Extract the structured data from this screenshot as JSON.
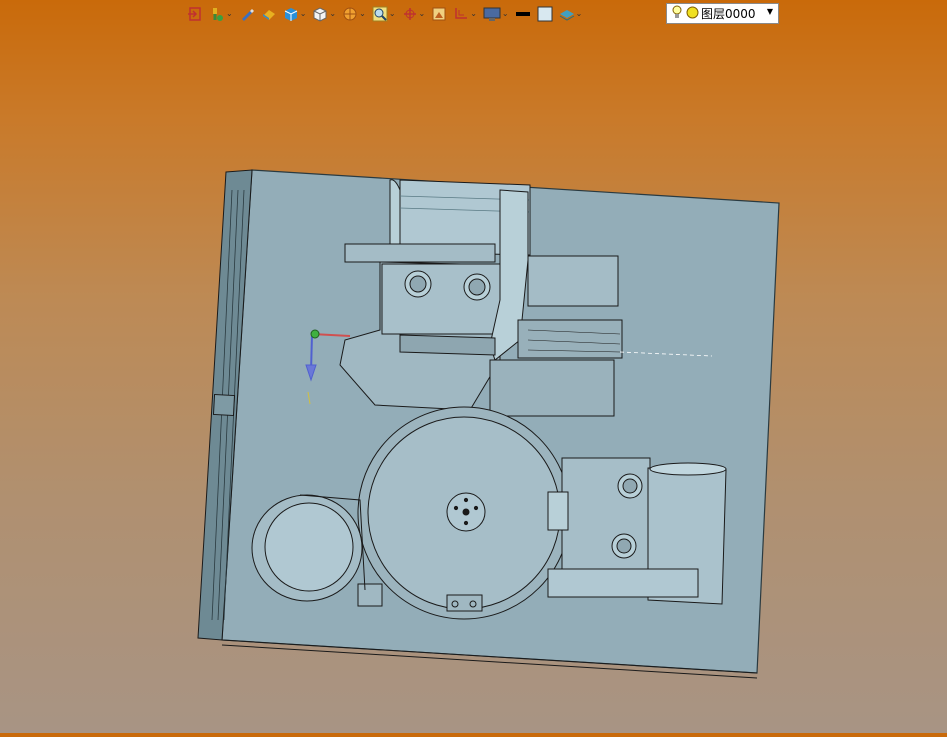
{
  "toolbar": {
    "buttons": [
      {
        "name": "exit-sketch-icon",
        "has_dropdown": false
      },
      {
        "name": "paint-tool-icon",
        "has_dropdown": true
      },
      {
        "name": "pencil-icon",
        "has_dropdown": false
      },
      {
        "name": "eraser-icon",
        "has_dropdown": false
      },
      {
        "name": "solid-box-icon",
        "has_dropdown": true
      },
      {
        "name": "view-cube-icon",
        "has_dropdown": true
      },
      {
        "name": "render-style-icon",
        "has_dropdown": true
      },
      {
        "name": "zoom-icon",
        "has_dropdown": true
      },
      {
        "name": "coordinate-axes-icon",
        "has_dropdown": true
      },
      {
        "name": "picture-frame-icon",
        "has_dropdown": false
      },
      {
        "name": "section-view-icon",
        "has_dropdown": true
      },
      {
        "name": "display-monitor-icon",
        "has_dropdown": true
      },
      {
        "name": "line-color-icon",
        "has_dropdown": false
      },
      {
        "name": "fill-color-icon",
        "has_dropdown": false
      },
      {
        "name": "layer-stack-icon",
        "has_dropdown": true
      }
    ],
    "layer": {
      "current": "图层0000",
      "visible_icon": "lightbulb-icon",
      "state_icon": "yellow-circle-icon"
    }
  },
  "colors": {
    "background_top": "#c96a0a",
    "background_bottom": "#a89484",
    "model_plate": "#93adb8",
    "model_lines": "#1a1a1a",
    "axis_x": "#d05050",
    "axis_y": "#5060d0",
    "axis_origin": "#40b040"
  }
}
